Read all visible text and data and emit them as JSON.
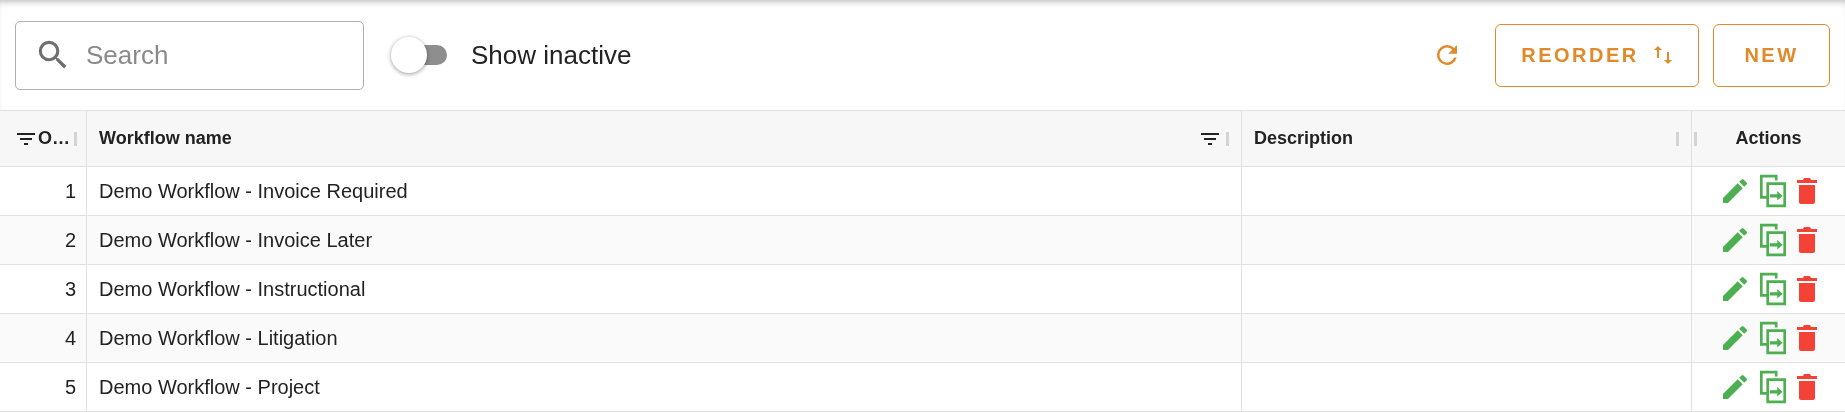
{
  "search": {
    "placeholder": "Search"
  },
  "toggle": {
    "label": "Show inactive",
    "on": false
  },
  "buttons": [
    {
      "kind": "reorder",
      "label": "REORDER"
    },
    {
      "kind": "new",
      "label": "NEW"
    }
  ],
  "table": {
    "columns": [
      {
        "label": "O…",
        "kind": "order",
        "filter": true
      },
      {
        "label": "Workflow name",
        "kind": "name",
        "filter": true
      },
      {
        "label": "Description",
        "kind": "description",
        "filter": false
      },
      {
        "label": "Actions",
        "kind": "actions",
        "filter": false
      }
    ],
    "rows": [
      {
        "order": "1",
        "name": "Demo Workflow - Invoice Required"
      },
      {
        "order": "2",
        "name": "Demo Workflow - Invoice Later"
      },
      {
        "order": "3",
        "name": "Demo Workflow - Instructional"
      },
      {
        "order": "4",
        "name": "Demo Workflow - Litigation"
      },
      {
        "order": "5",
        "name": "Demo Workflow - Project"
      }
    ]
  }
}
